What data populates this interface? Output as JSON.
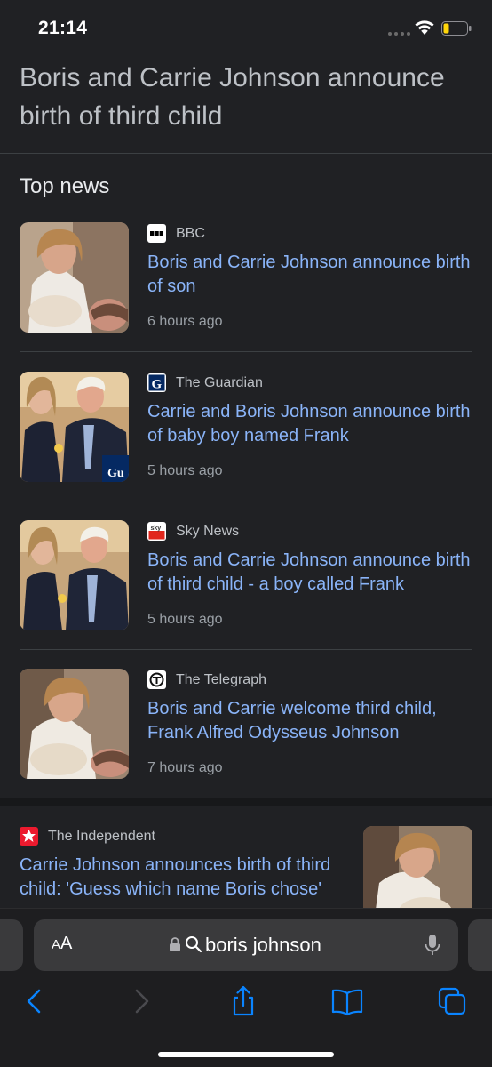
{
  "status_bar": {
    "time": "21:14"
  },
  "headline": "Boris and Carrie Johnson announce birth of third child",
  "section_title": "Top news",
  "articles": [
    {
      "source": "BBC",
      "title": "Boris and Carrie Johnson announce birth of son",
      "time": "6 hours ago"
    },
    {
      "source": "The Guardian",
      "title": "Carrie and Boris Johnson announce birth of baby boy named Frank",
      "time": "5 hours ago"
    },
    {
      "source": "Sky News",
      "title": "Boris and Carrie Johnson announce birth of third child - a boy called Frank",
      "time": "5 hours ago"
    },
    {
      "source": "The Telegraph",
      "title": "Boris and Carrie welcome third child, Frank Alfred Odysseus Johnson",
      "time": "7 hours ago"
    },
    {
      "source": "The Independent",
      "title": "Carrie Johnson announces birth of third child: 'Guess which name Boris chose'"
    }
  ],
  "address_bar": {
    "aa_label_small": "A",
    "aa_label_large": "A",
    "text": "boris johnson"
  },
  "toolbar": [
    "back-icon",
    "forward-icon",
    "share-icon",
    "bookmarks-icon",
    "tabs-icon"
  ],
  "colors": {
    "link": "#8ab4f8",
    "accent": "#0a84ff",
    "background": "#202124"
  }
}
